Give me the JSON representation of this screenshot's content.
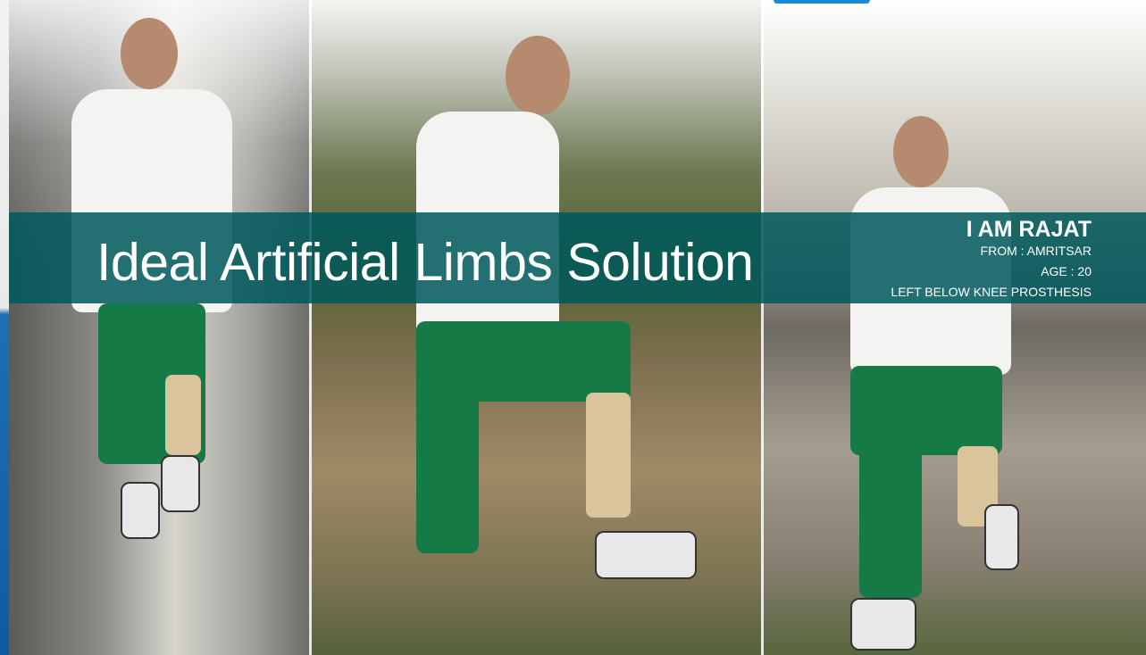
{
  "banner": {
    "title": "Ideal Artificial Limbs Solution"
  },
  "profile": {
    "name": "I AM RAJAT",
    "from": "FROM : AMRITSAR",
    "age": "AGE : 20",
    "condition": "LEFT BELOW KNEE PROSTHESIS"
  },
  "colors": {
    "banner_overlay": "#00585c",
    "accent_blue": "#1c89d6",
    "text": "#ffffff"
  }
}
